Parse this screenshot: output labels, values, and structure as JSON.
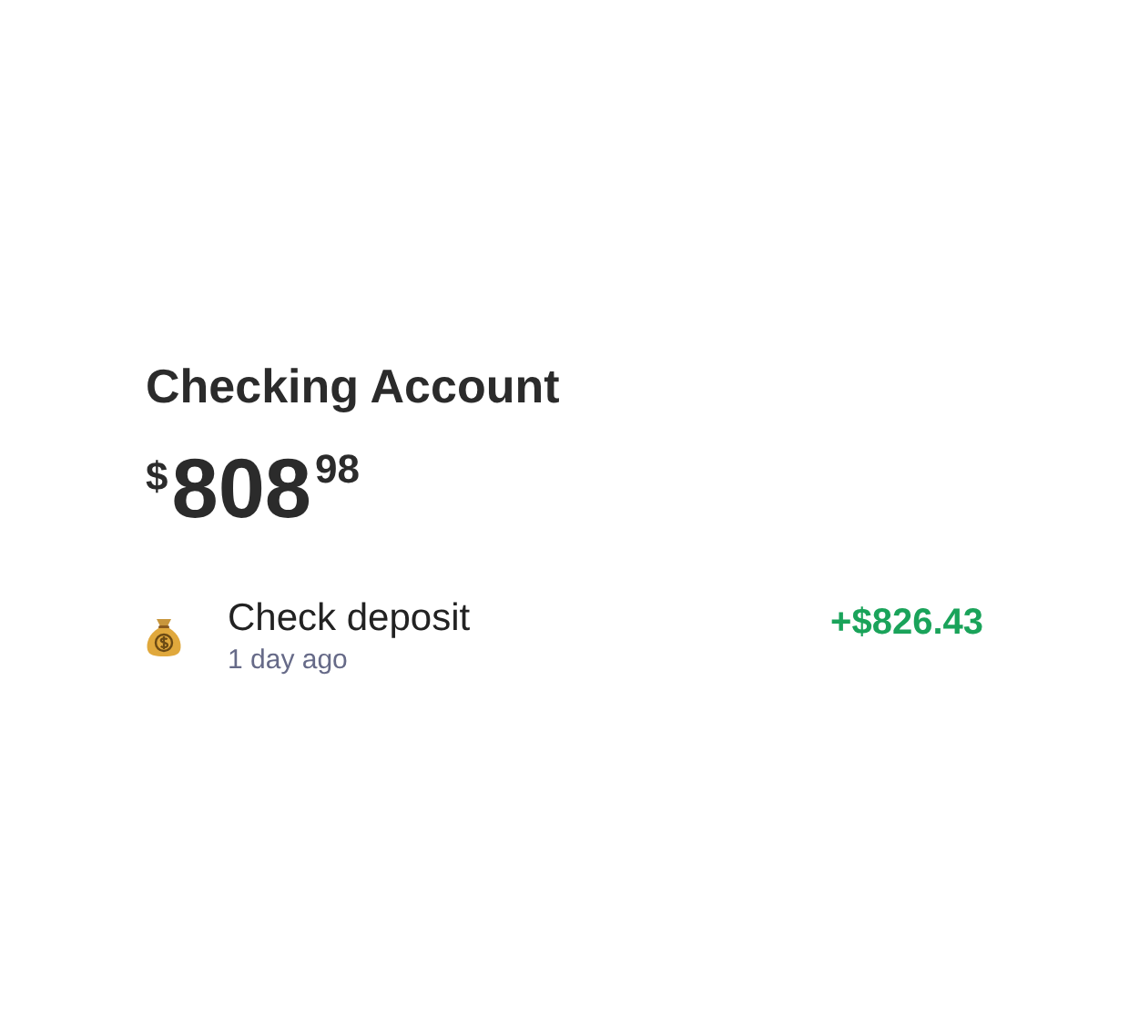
{
  "account": {
    "title": "Checking Account",
    "balance": {
      "currency": "$",
      "whole": "808",
      "cents": "98"
    }
  },
  "transactions": [
    {
      "kind": "deposit",
      "title": "Check deposit",
      "time": "1 day ago",
      "amount": "+$826.43"
    }
  ]
}
